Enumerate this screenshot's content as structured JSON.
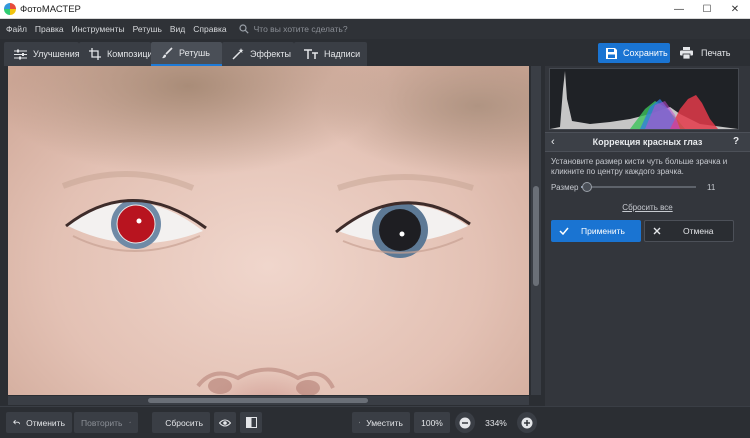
{
  "window": {
    "title": "ФотоМАСТЕР",
    "controls": {
      "minimize": "—",
      "maximize": "☐",
      "close": "✕"
    }
  },
  "menu": {
    "items": [
      "Файл",
      "Правка",
      "Инструменты",
      "Ретушь",
      "Вид",
      "Справка"
    ],
    "search_placeholder": "Что вы хотите сделать?"
  },
  "tabs": [
    {
      "label": "Улучшения",
      "icon": "sliders-icon"
    },
    {
      "label": "Композиция",
      "icon": "crop-icon"
    },
    {
      "label": "Ретушь",
      "icon": "brush-icon",
      "active": true
    },
    {
      "label": "Эффекты",
      "icon": "magic-wand-icon"
    },
    {
      "label": "Надписи",
      "icon": "text-icon"
    }
  ],
  "toolbar": {
    "save_label": "Сохранить",
    "print_label": "Печать"
  },
  "panel": {
    "title": "Коррекция красных глаз",
    "back_icon": "‹",
    "help_label": "?",
    "hint": "Установите размер кисти чуть больше зрачка и кликните по центру каждого зрачка.",
    "size_label": "Размер",
    "size_value": "11",
    "size_fraction": 0.05,
    "reset_label": "Сбросить все",
    "apply_label": "Применить",
    "cancel_label": "Отмена"
  },
  "bottom": {
    "undo_label": "Отменить",
    "redo_label": "Повторить",
    "reset_label": "Сбросить",
    "fit_label": "Уместить",
    "zoom_preset": "100%",
    "zoom_value": "334%"
  },
  "colors": {
    "accent": "#1a74d2",
    "background": "#2b2e33",
    "panel": "#33363c"
  }
}
